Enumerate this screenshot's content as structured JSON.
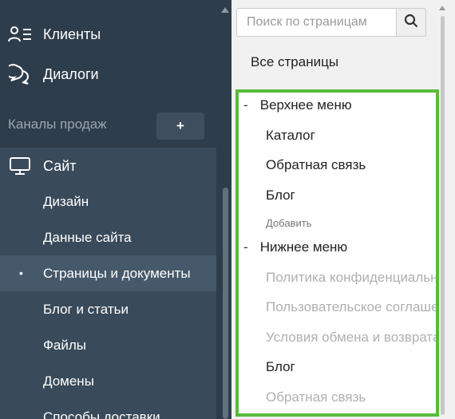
{
  "sidebar": {
    "items": [
      {
        "label": "Клиенты",
        "icon": "clients-icon"
      },
      {
        "label": "Диалоги",
        "icon": "dialogs-icon"
      }
    ],
    "section_label": "Каналы продаж",
    "add_button": "+",
    "site": {
      "label": "Сайт",
      "icon": "monitor-icon",
      "children": [
        "Дизайн",
        "Данные сайта",
        "Страницы и документы",
        "Блог и статьи",
        "Файлы",
        "Домены",
        "Способы доставки"
      ],
      "active_index": 2,
      "bullet": "•"
    }
  },
  "right": {
    "search": {
      "placeholder": "Поиск по страницам",
      "value": ""
    },
    "all_pages": "Все страницы",
    "tree": {
      "top_menu": {
        "dash": "-",
        "label": "Верхнее меню"
      },
      "top_items": [
        "Каталог",
        "Обратная связь",
        "Блог"
      ],
      "add_label": "Добавить",
      "bottom_menu": {
        "dash": "-",
        "label": "Нижнее меню"
      },
      "bottom_items": [
        {
          "label": "Политика конфиденциальности",
          "muted": true
        },
        {
          "label": "Пользовательское соглашение",
          "muted": true
        },
        {
          "label": "Условия обмена и возврата",
          "muted": true
        },
        {
          "label": "Блог",
          "muted": false
        },
        {
          "label": "Обратная связь",
          "muted": true
        }
      ]
    }
  },
  "colors": {
    "sidebar_bg": "#2e3d4b",
    "site_panel_bg": "#394a5a",
    "active_bg": "#46596b",
    "highlight_border": "#59bb3a",
    "muted_text": "#b0b0b0"
  }
}
